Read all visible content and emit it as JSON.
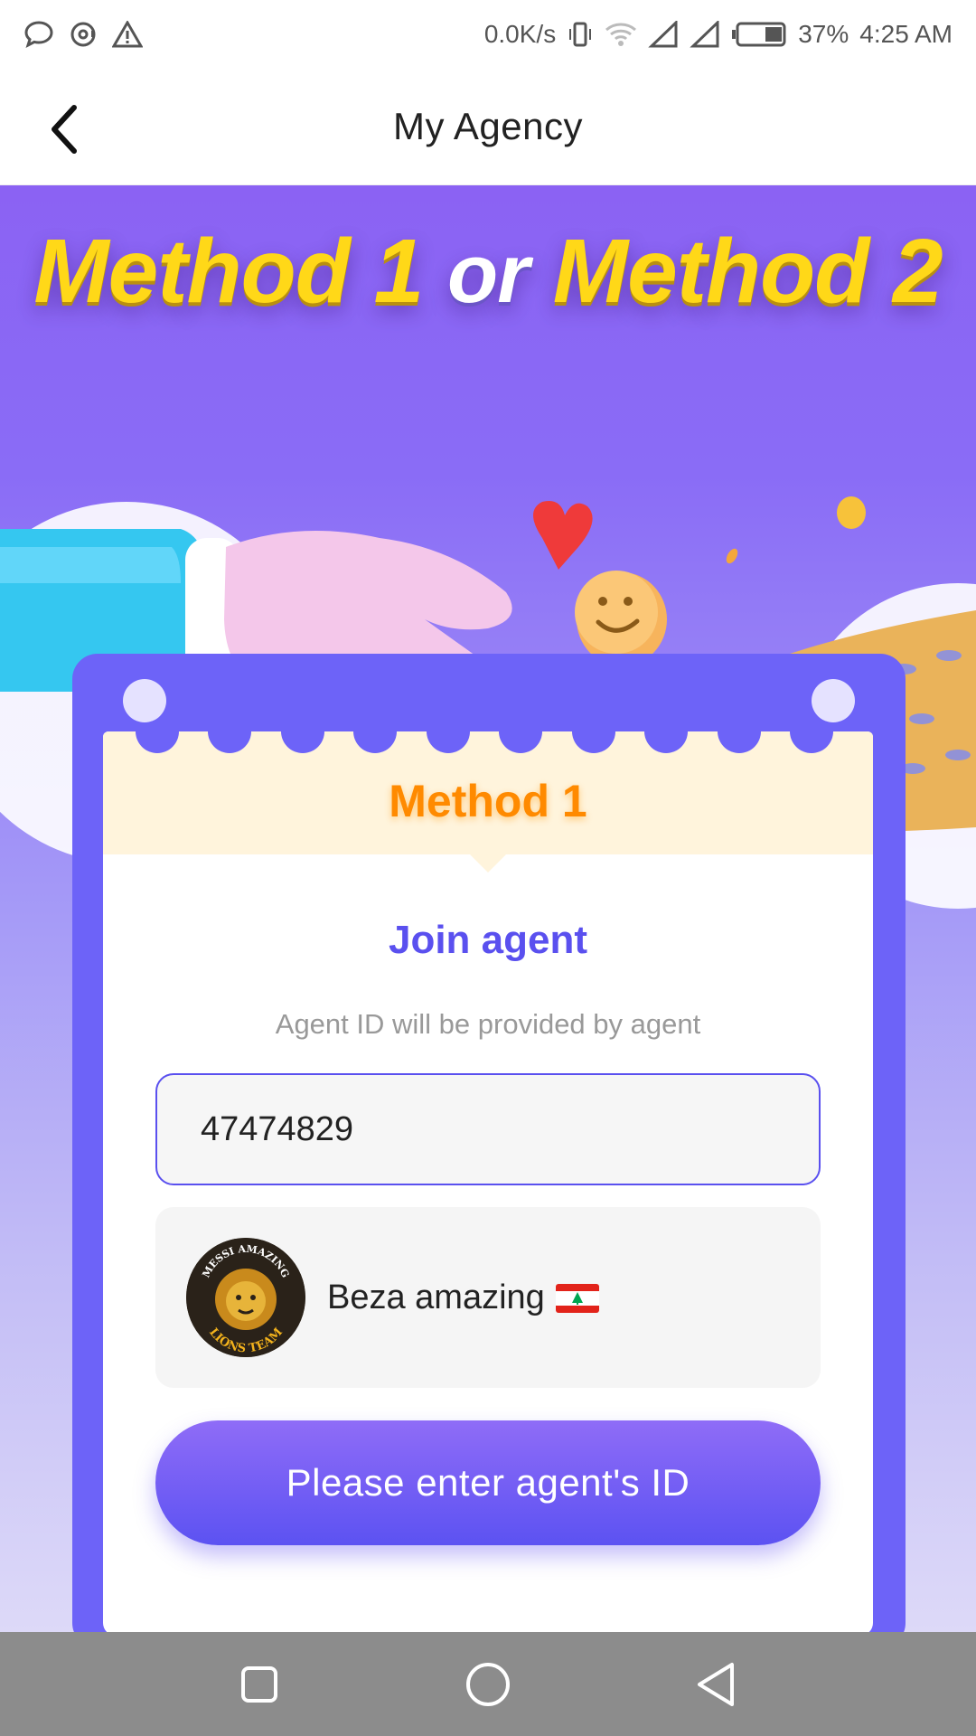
{
  "status_bar": {
    "network_speed": "0.0K/s",
    "battery": "37%",
    "time": "4:25 AM",
    "icons": [
      "chat-bubble-icon",
      "alarm-icon",
      "warning-icon",
      "vibrate-icon",
      "wifi-icon",
      "signal-icon",
      "signal-icon",
      "battery-icon"
    ]
  },
  "header": {
    "title": "My Agency",
    "back_icon": "chevron-left-icon"
  },
  "hero": {
    "title_part1": "Method 1",
    "title_or": "or",
    "title_part2": "Method 2"
  },
  "card": {
    "method_label": "Method 1",
    "join_title": "Join agent",
    "hint": "Agent ID will be provided by agent",
    "agent_id_value": "47474829",
    "agent": {
      "name": "Beza amazing",
      "flag_icon": "lebanon-flag-icon",
      "avatar_text_top": "MESSI AMAZING",
      "avatar_text_bottom": "LIONS TEAM"
    },
    "submit_label": "Please enter agent's ID"
  },
  "colors": {
    "accent": "#5a50ef",
    "title_yellow": "#ffd818",
    "method_orange": "#ff8a00",
    "card_purple": "#6d63f8"
  },
  "nav_bar": {
    "icons": [
      "recent-apps-icon",
      "home-icon",
      "back-triangle-icon"
    ]
  }
}
